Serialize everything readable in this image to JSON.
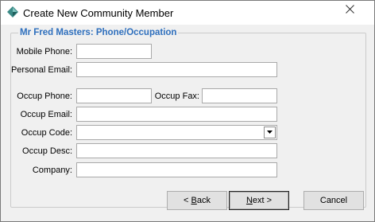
{
  "window": {
    "title": "Create New Community Member",
    "icon": "app-diamond-icon",
    "close_icon": "close-icon"
  },
  "group": {
    "legend": "Mr Fred Masters: Phone/Occupation"
  },
  "fields": {
    "mobile_phone": {
      "label": "Mobile Phone:",
      "value": ""
    },
    "personal_email": {
      "label": "Personal Email:",
      "value": ""
    },
    "occup_phone": {
      "label": "Occup Phone:",
      "value": ""
    },
    "occup_fax": {
      "label": "Occup Fax:",
      "value": ""
    },
    "occup_email": {
      "label": "Occup Email:",
      "value": ""
    },
    "occup_code": {
      "label": "Occup Code:",
      "value": ""
    },
    "occup_desc": {
      "label": "Occup Desc:",
      "value": ""
    },
    "company": {
      "label": "Company:",
      "value": ""
    }
  },
  "buttons": {
    "back_prefix": "< ",
    "back_mnemonic": "B",
    "back_rest": "ack",
    "next_mnemonic": "N",
    "next_rest": "ext >",
    "cancel": "Cancel"
  }
}
